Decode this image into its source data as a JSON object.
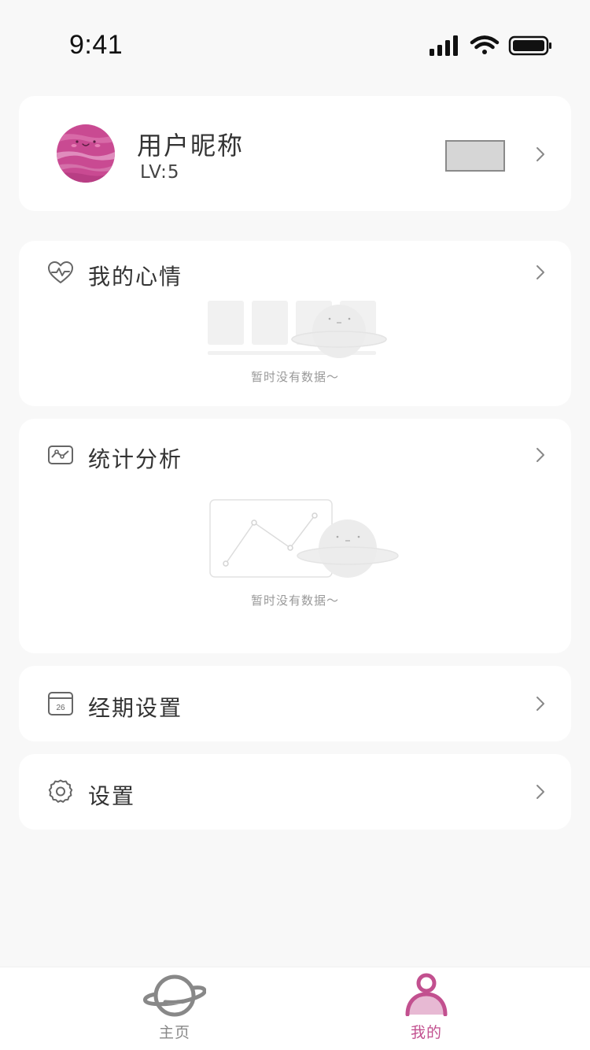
{
  "status_bar": {
    "time": "9:41"
  },
  "profile": {
    "nickname": "用户昵称",
    "level": "LV:5",
    "avatar_icon": "planet-avatar-icon"
  },
  "sections": {
    "mood": {
      "title": "我的心情",
      "empty_text": "暂时没有数据～",
      "icon": "heart-pulse-icon"
    },
    "stats": {
      "title": "统计分析",
      "empty_text": "暂时没有数据～",
      "icon": "chart-card-icon"
    },
    "period": {
      "title": "经期设置",
      "icon": "calendar-icon",
      "calendar_day": "26"
    },
    "settings": {
      "title": "设置",
      "icon": "gear-icon"
    }
  },
  "tab_bar": {
    "tabs": [
      {
        "label": "主页",
        "icon": "planet-icon",
        "active": false
      },
      {
        "label": "我的",
        "icon": "person-icon",
        "active": true
      }
    ]
  },
  "colors": {
    "accent": "#c2508f",
    "background": "#f8f8f8",
    "card": "#ffffff",
    "inactive_tab": "#888888"
  }
}
